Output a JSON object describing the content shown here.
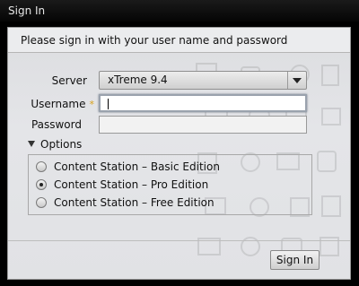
{
  "window": {
    "title": "Sign In"
  },
  "form": {
    "heading": "Please sign in with your user name and password",
    "server_label": "Server",
    "server_value": "xTreme 9.4",
    "username_label": "Username",
    "username_required": "*",
    "username_value": "",
    "password_label": "Password",
    "password_value": ""
  },
  "options": {
    "toggle_label": "Options",
    "items": [
      {
        "label": "Content Station – Basic Edition",
        "checked": false
      },
      {
        "label": "Content Station – Pro Edition",
        "checked": true
      },
      {
        "label": "Content Station – Free Edition",
        "checked": false
      }
    ]
  },
  "footer": {
    "signin_label": "Sign In"
  },
  "icons": [
    "dropdown-arrow-icon",
    "options-expand-icon",
    "radio-icon"
  ]
}
